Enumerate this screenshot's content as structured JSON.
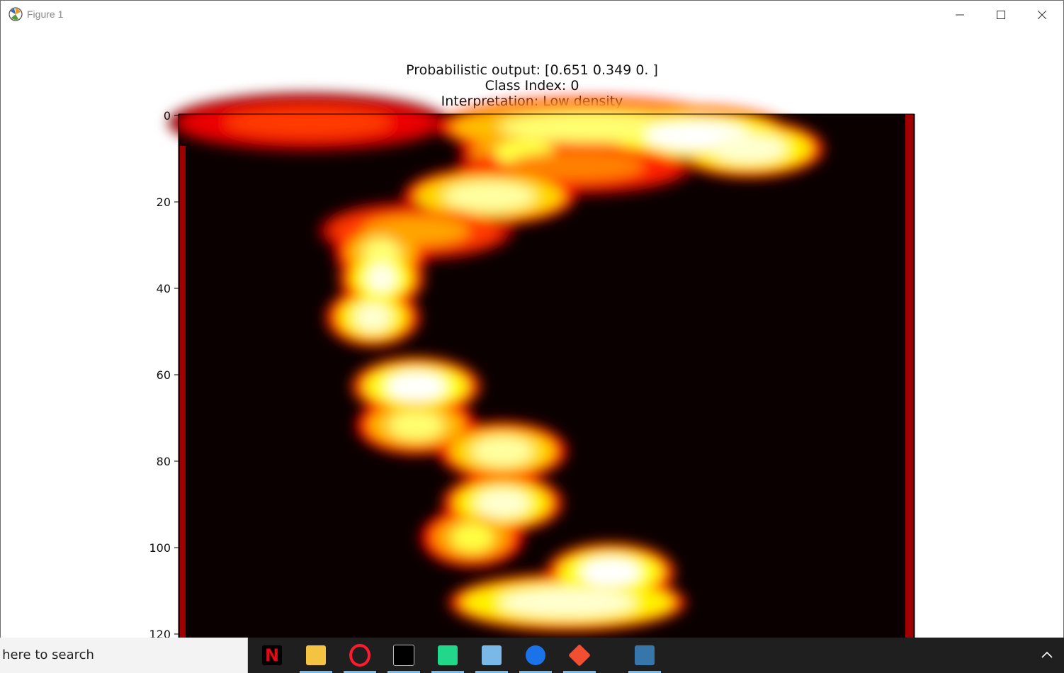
{
  "window": {
    "title": "Figure 1"
  },
  "figure": {
    "title_lines": [
      "Probabilistic output: [0.651 0.349 0.   ]",
      "Class Index: 0",
      "Interpretation: Low density"
    ],
    "y_ticks": [
      "0",
      "20",
      "40",
      "60",
      "80",
      "100",
      "120"
    ]
  },
  "chart_data": {
    "type": "heatmap",
    "title": "Probabilistic output: [0.651 0.349 0.   ]\nClass Index: 0\nInterpretation: Low density",
    "colormap": "hot",
    "y_tick_labels": [
      "0",
      "20",
      "40",
      "60",
      "80",
      "100",
      "120"
    ],
    "ylim": [
      120,
      0
    ],
    "grid": false,
    "band": [
      {
        "row": 2,
        "col": 30,
        "w": 55,
        "v": 0.45
      },
      {
        "row": 3,
        "col": 95,
        "w": 60,
        "v": 0.85
      },
      {
        "row": 5,
        "col": 120,
        "w": 35,
        "v": 1.0
      },
      {
        "row": 8,
        "col": 132,
        "w": 25,
        "v": 0.95
      },
      {
        "row": 9,
        "col": 80,
        "w": 20,
        "v": 0.8
      },
      {
        "row": 12,
        "col": 92,
        "w": 45,
        "v": 0.55
      },
      {
        "row": 19,
        "col": 72,
        "w": 30,
        "v": 0.9
      },
      {
        "row": 27,
        "col": 55,
        "w": 35,
        "v": 0.6
      },
      {
        "row": 32,
        "col": 47,
        "w": 12,
        "v": 0.85
      },
      {
        "row": 38,
        "col": 47,
        "w": 10,
        "v": 0.98
      },
      {
        "row": 47,
        "col": 45,
        "w": 12,
        "v": 0.95
      },
      {
        "row": 63,
        "col": 55,
        "w": 20,
        "v": 1.0
      },
      {
        "row": 72,
        "col": 55,
        "w": 18,
        "v": 0.85
      },
      {
        "row": 78,
        "col": 75,
        "w": 20,
        "v": 0.9
      },
      {
        "row": 90,
        "col": 75,
        "w": 18,
        "v": 0.95
      },
      {
        "row": 98,
        "col": 68,
        "w": 14,
        "v": 0.8
      },
      {
        "row": 106,
        "col": 100,
        "w": 20,
        "v": 1.0
      },
      {
        "row": 113,
        "col": 90,
        "w": 45,
        "v": 0.95
      }
    ]
  },
  "taskbar": {
    "search_placeholder": "Type here to search",
    "apps": [
      {
        "name": "netflix-icon",
        "color": "#e50914",
        "active": false
      },
      {
        "name": "file-explorer-icon",
        "color": "#f5c342",
        "active": true
      },
      {
        "name": "opera-icon",
        "color": "#ff1b2d",
        "active": true
      },
      {
        "name": "terminal-icon",
        "color": "#000000",
        "active": true
      },
      {
        "name": "pycharm-icon",
        "color": "#21d789",
        "active": true
      },
      {
        "name": "notepad-icon",
        "color": "#7ab8e8",
        "active": true
      },
      {
        "name": "maps-icon",
        "color": "#1a73e8",
        "active": true
      },
      {
        "name": "git-icon",
        "color": "#f14e32",
        "active": true
      },
      {
        "name": "python-icon",
        "color": "#3776ab",
        "active": true
      }
    ]
  }
}
